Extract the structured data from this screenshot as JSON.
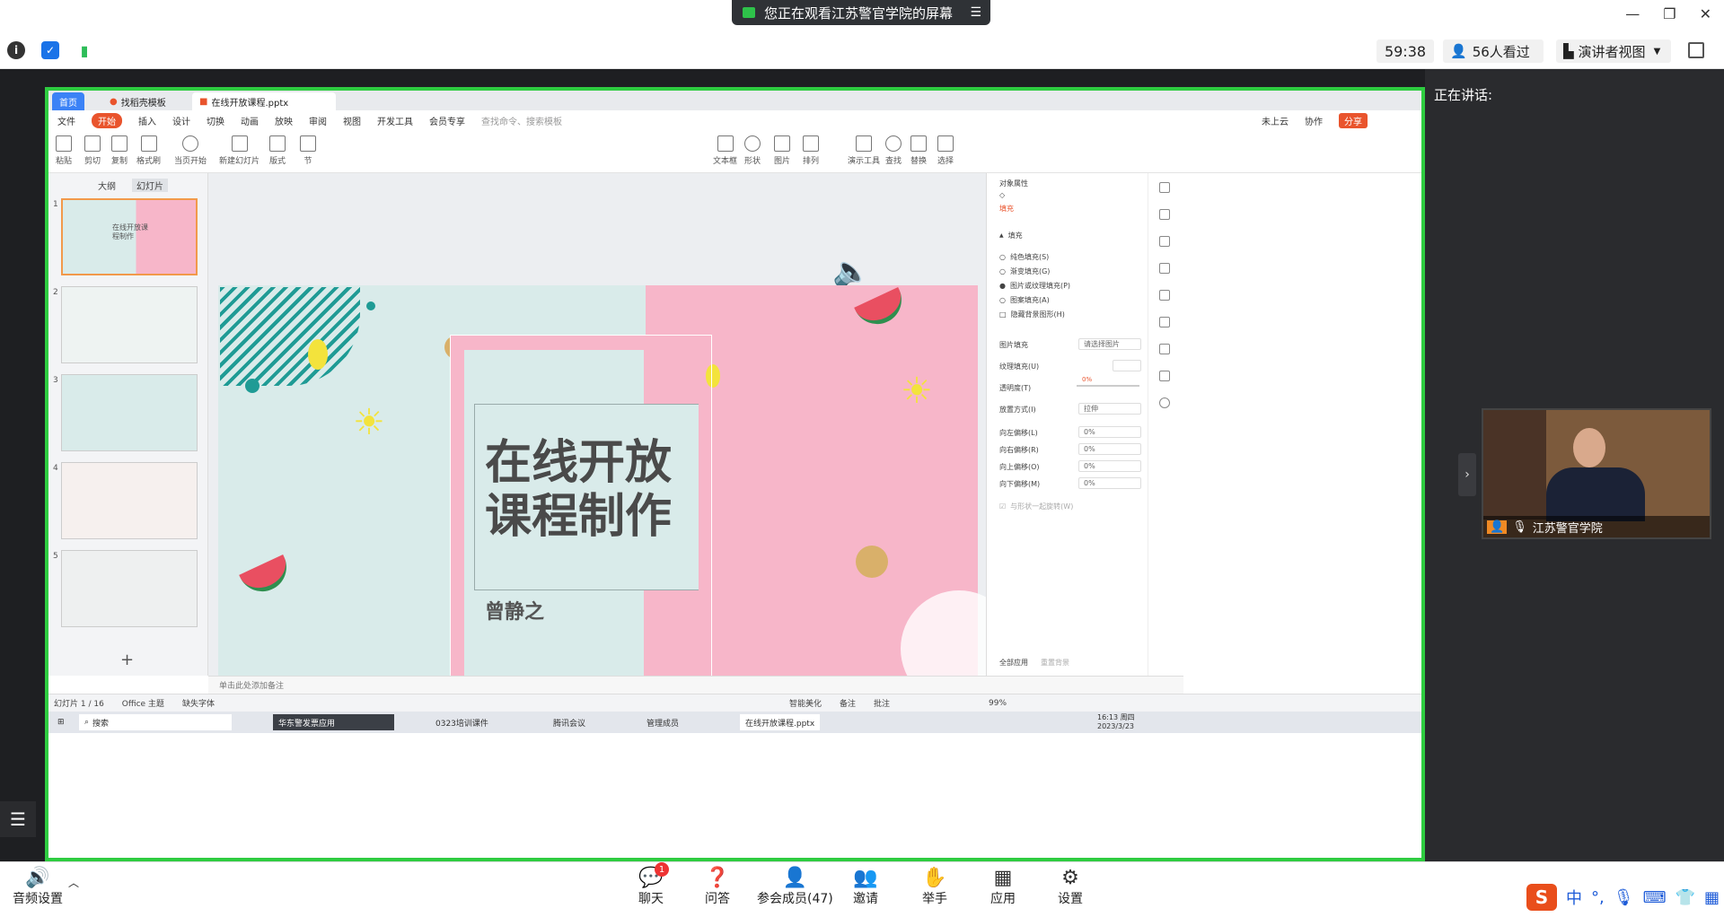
{
  "share_banner": {
    "text": "您正在观看江苏警官学院的屏幕",
    "menu_icon": "list-icon"
  },
  "window_controls": {
    "minimize": "—",
    "restore": "❐",
    "close": "✕"
  },
  "info_bar": {
    "timer": "59:38",
    "viewers": "56人看过",
    "view_mode": "演讲者视图"
  },
  "speaker_panel": {
    "label": "正在讲话:",
    "video_name": "江苏警官学院"
  },
  "wps": {
    "tabs": [
      "首页",
      "找稻壳模板",
      "在线开放课程.pptx"
    ],
    "menu": [
      "文件",
      "开始",
      "插入",
      "设计",
      "切换",
      "动画",
      "放映",
      "审阅",
      "视图",
      "开发工具",
      "会员专享",
      "查找命令、搜索模板"
    ],
    "menu_right": [
      "未上云",
      "协作",
      "分享"
    ],
    "ribbon": [
      "粘贴",
      "剪切",
      "复制",
      "格式刷",
      "当页开始",
      "新建幻灯片",
      "版式",
      "节",
      "文本框",
      "形状",
      "图片",
      "排列",
      "演示工具",
      "查找",
      "替换",
      "选择"
    ],
    "thumb_tabs": [
      "大纲",
      "幻灯片"
    ],
    "thumb_numbers": [
      "1",
      "2",
      "3",
      "4",
      "5"
    ],
    "thumb1_text": "在线开放课程制作",
    "slide": {
      "title": "在线开放课程制作",
      "author": "曾静之"
    },
    "props": {
      "header": "对象属性",
      "tab": "填充",
      "section": "填充",
      "options": [
        "纯色填充(S)",
        "渐变填充(G)",
        "图片或纹理填充(P)",
        "图案填充(A)",
        "隐藏背景图形(H)"
      ],
      "image_fill_label": "图片填充",
      "image_fill_value": "请选择图片",
      "texture_label": "纹理填充(U)",
      "transparency_label": "透明度(T)",
      "transparency_value": "0%",
      "placement_label": "放置方式(I)",
      "placement_value": "拉伸",
      "offsets": [
        {
          "label": "向左偏移(L)",
          "value": "0%"
        },
        {
          "label": "向右偏移(R)",
          "value": "0%"
        },
        {
          "label": "向上偏移(O)",
          "value": "0%"
        },
        {
          "label": "向下偏移(M)",
          "value": "0%"
        }
      ],
      "rotate": "与形状一起旋转(W)",
      "apply_all": "全部应用",
      "reset": "重置背景"
    },
    "notes_placeholder": "单击此处添加备注",
    "status": {
      "slide_count": "幻灯片 1 / 16",
      "theme": "Office 主题",
      "font": "缺失字体",
      "beautify": "智能美化",
      "notes": "备注",
      "comments": "批注",
      "zoom": "99%"
    }
  },
  "win_taskbar": {
    "search": "搜索",
    "items": [
      "华东警发票应用",
      "0323培训课件",
      "腾讯会议",
      "管理成员",
      "在线开放课程.pptx"
    ],
    "clock_time": "16:13 周四",
    "clock_date": "2023/3/23"
  },
  "bottom_bar": {
    "audio": "音频设置",
    "buttons": [
      {
        "label": "聊天",
        "icon": "chat-icon"
      },
      {
        "label": "问答",
        "icon": "question-icon"
      },
      {
        "label": "参会成员(47)",
        "icon": "members-icon"
      },
      {
        "label": "邀请",
        "icon": "invite-icon"
      },
      {
        "label": "举手",
        "icon": "hand-icon"
      },
      {
        "label": "应用",
        "icon": "apps-icon"
      },
      {
        "label": "设置",
        "icon": "gear-icon"
      }
    ],
    "chat_badge": "1",
    "ime": "中"
  },
  "colors": {
    "share_border": "#2ecc40",
    "wps_accent": "#e9542d",
    "slide_teal": "#d9ebea",
    "slide_pink": "#f7b6c9"
  }
}
